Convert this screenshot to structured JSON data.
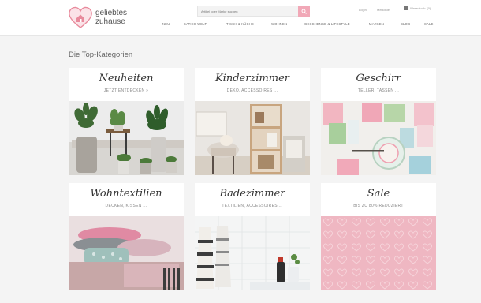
{
  "header": {
    "brand_line1": "geliebtes",
    "brand_line2": "zuhause",
    "search_placeholder": "Artikel oder Marke suchen",
    "toplinks": [
      "Login",
      "Merkliste"
    ],
    "cart_label": "Warenkorb",
    "cart_count": "(0)",
    "nav": [
      "NEU",
      "KATIES WELT",
      "TISCH & KÜCHE",
      "WOHNEN",
      "GESCHENKE & LIFESTYLE",
      "MARKEN",
      "BLOG",
      "SALE"
    ]
  },
  "page_title": "Die Top-Kategorien",
  "tiles": [
    {
      "title": "Neuheiten",
      "subtitle": "JETZT ENTDECKEN »"
    },
    {
      "title": "Kinderzimmer",
      "subtitle": "DEKO, ACCESSOIRES ..."
    },
    {
      "title": "Geschirr",
      "subtitle": "TELLER, TASSEN ..."
    },
    {
      "title": "Wohntextilien",
      "subtitle": "DECKEN, KISSEN ..."
    },
    {
      "title": "Badezimmer",
      "subtitle": "TEXTILIEN, ACCESSOIRES ..."
    },
    {
      "title": "Sale",
      "subtitle": "BIS ZU 80% REDUZIERT"
    }
  ],
  "colors": {
    "accent": "#f1a8b7",
    "sale_pink": "#efb7c2"
  }
}
